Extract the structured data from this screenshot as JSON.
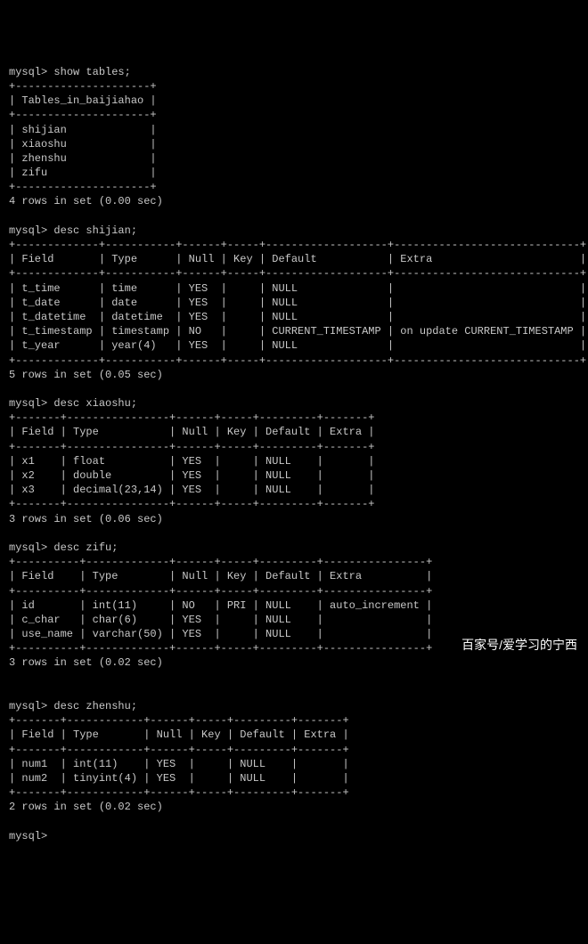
{
  "prompt": "mysql>",
  "commands": {
    "show_tables": "show tables;",
    "desc_shijian": "desc shijian;",
    "desc_xiaoshu": "desc xiaoshu;",
    "desc_zifu": "desc zifu;",
    "desc_zhenshu": "desc zhenshu;"
  },
  "tables_list": {
    "header": "Tables_in_baijiahao",
    "rows": [
      "shijian",
      "xiaoshu",
      "zhenshu",
      "zifu"
    ],
    "footer": "4 rows in set (0.00 sec)"
  },
  "desc_headers": [
    "Field",
    "Type",
    "Null",
    "Key",
    "Default",
    "Extra"
  ],
  "shijian": {
    "rows": [
      {
        "Field": "t_time",
        "Type": "time",
        "Null": "YES",
        "Key": "",
        "Default": "NULL",
        "Extra": ""
      },
      {
        "Field": "t_date",
        "Type": "date",
        "Null": "YES",
        "Key": "",
        "Default": "NULL",
        "Extra": ""
      },
      {
        "Field": "t_datetime",
        "Type": "datetime",
        "Null": "YES",
        "Key": "",
        "Default": "NULL",
        "Extra": ""
      },
      {
        "Field": "t_timestamp",
        "Type": "timestamp",
        "Null": "NO",
        "Key": "",
        "Default": "CURRENT_TIMESTAMP",
        "Extra": "on update CURRENT_TIMESTAMP"
      },
      {
        "Field": "t_year",
        "Type": "year(4)",
        "Null": "YES",
        "Key": "",
        "Default": "NULL",
        "Extra": ""
      }
    ],
    "footer": "5 rows in set (0.05 sec)"
  },
  "xiaoshu": {
    "rows": [
      {
        "Field": "x1",
        "Type": "float",
        "Null": "YES",
        "Key": "",
        "Default": "NULL",
        "Extra": ""
      },
      {
        "Field": "x2",
        "Type": "double",
        "Null": "YES",
        "Key": "",
        "Default": "NULL",
        "Extra": ""
      },
      {
        "Field": "x3",
        "Type": "decimal(23,14)",
        "Null": "YES",
        "Key": "",
        "Default": "NULL",
        "Extra": ""
      }
    ],
    "footer": "3 rows in set (0.06 sec)"
  },
  "zifu": {
    "rows": [
      {
        "Field": "id",
        "Type": "int(11)",
        "Null": "NO",
        "Key": "PRI",
        "Default": "NULL",
        "Extra": "auto_increment"
      },
      {
        "Field": "c_char",
        "Type": "char(6)",
        "Null": "YES",
        "Key": "",
        "Default": "NULL",
        "Extra": ""
      },
      {
        "Field": "use_name",
        "Type": "varchar(50)",
        "Null": "YES",
        "Key": "",
        "Default": "NULL",
        "Extra": ""
      }
    ],
    "footer": "3 rows in set (0.02 sec)"
  },
  "zhenshu": {
    "rows": [
      {
        "Field": "num1",
        "Type": "int(11)",
        "Null": "YES",
        "Key": "",
        "Default": "NULL",
        "Extra": ""
      },
      {
        "Field": "num2",
        "Type": "tinyint(4)",
        "Null": "YES",
        "Key": "",
        "Default": "NULL",
        "Extra": ""
      }
    ],
    "footer": "2 rows in set (0.02 sec)"
  },
  "watermark": "百家号/爱学习的宁西"
}
